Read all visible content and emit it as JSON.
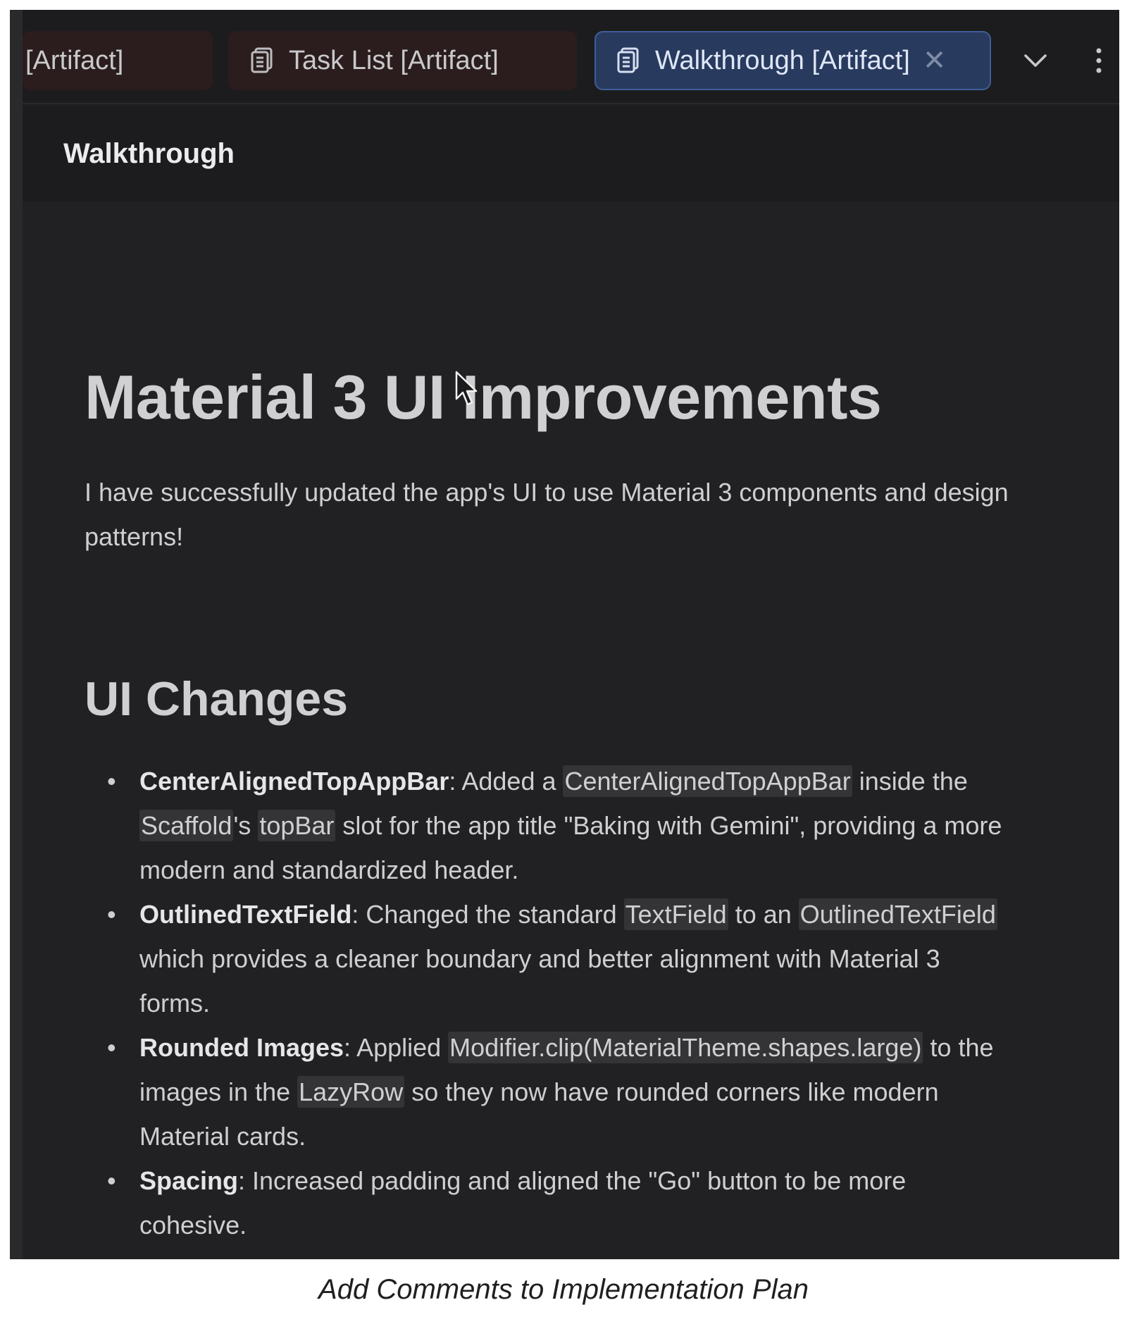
{
  "tabs": [
    {
      "label": "[Artifact]"
    },
    {
      "label": "Task List [Artifact]"
    },
    {
      "label": "Walkthrough [Artifact]",
      "active": true
    }
  ],
  "header": {
    "title": "Walkthrough"
  },
  "doc": {
    "title": "Material 3 UI Improvements",
    "intro": "I have successfully updated the app's UI to use Material 3 components and design patterns!",
    "section_title": "UI Changes",
    "items": [
      {
        "term": "CenterAlignedTopAppBar",
        "p1": ": Added a ",
        "c1": "CenterAlignedTopAppBar",
        "p2": " inside the ",
        "c2": "Scaffold",
        "p3": "'s ",
        "c3": "topBar",
        "p4": " slot for the app title \"Baking with Gemini\", providing a more modern and standardized header."
      },
      {
        "term": "OutlinedTextField",
        "p1": ": Changed the standard ",
        "c1": "TextField",
        "p2": " to an ",
        "c2": "OutlinedTextField",
        "p3": " which provides a cleaner boundary and better alignment with Material 3 forms."
      },
      {
        "term": "Rounded Images",
        "p1": ": Applied ",
        "c1": "Modifier.clip(MaterialTheme.shapes.large)",
        "p2": " to the images in the ",
        "c2": "LazyRow",
        "p3": " so they now have rounded corners like modern Material cards."
      },
      {
        "term": "Spacing",
        "p1": ": Increased padding and aligned the \"Go\" button to be more cohesive."
      }
    ]
  },
  "caption": "Add Comments to Implementation Plan",
  "colors": {
    "active_tab_bg": "#283a5e",
    "inactive_tab_bg": "#2b1d1e",
    "content_bg": "#212123",
    "code_bg": "#343437"
  },
  "icons": [
    "document-icon",
    "close-icon",
    "chevron-down-icon",
    "more-vert-icon",
    "mouse-cursor-icon"
  ]
}
